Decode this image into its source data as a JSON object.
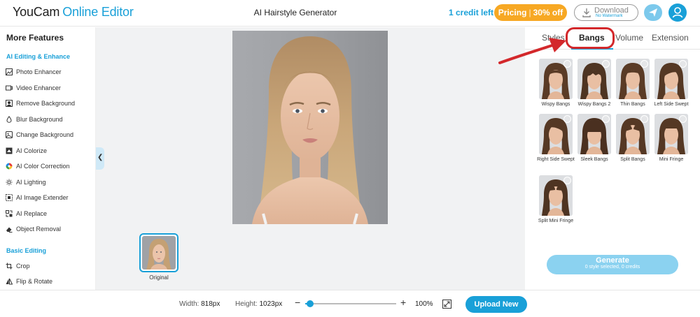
{
  "header": {
    "logo_brand": "YouCam",
    "logo_sub": "Online Editor",
    "page_title": "AI Hairstyle Generator",
    "credits": "1 credit left",
    "pricing_label": "Pricing",
    "pricing_discount": "30% off",
    "download_label": "Download",
    "download_sub": "No Watermark",
    "send_icon": "paper-plane-icon",
    "avatar_icon": "user-icon",
    "accent": "#19a0d8",
    "pricing_color": "#f7a823"
  },
  "sidebar": {
    "title": "More Features",
    "sections": [
      {
        "label": "AI Editing & Enhance",
        "items": [
          {
            "label": "Photo Enhancer",
            "icon": "image-enhance-icon"
          },
          {
            "label": "Video Enhancer",
            "icon": "video-icon"
          },
          {
            "label": "Remove Background",
            "icon": "remove-bg-icon"
          },
          {
            "label": "Blur Background",
            "icon": "droplet-icon"
          },
          {
            "label": "Change Background",
            "icon": "change-bg-icon"
          },
          {
            "label": "AI Colorize",
            "icon": "colorize-icon"
          },
          {
            "label": "AI Color Correction",
            "icon": "color-wheel-icon"
          },
          {
            "label": "AI Lighting",
            "icon": "sun-icon"
          },
          {
            "label": "AI Image Extender",
            "icon": "expand-icon"
          },
          {
            "label": "AI Replace",
            "icon": "replace-icon"
          },
          {
            "label": "Object Removal",
            "icon": "eraser-icon"
          }
        ]
      },
      {
        "label": "Basic Editing",
        "items": [
          {
            "label": "Crop",
            "icon": "crop-icon"
          },
          {
            "label": "Flip & Rotate",
            "icon": "flip-icon"
          }
        ]
      }
    ],
    "collapse_icon": "chevron-left-icon"
  },
  "canvas": {
    "thumb_label": "Original"
  },
  "right_panel": {
    "tabs": [
      "Styles",
      "Bangs",
      "Volume",
      "Extension"
    ],
    "active_tab": "Bangs",
    "styles": [
      "Wispy Bangs",
      "Wispy Bangs 2",
      "Thin Bangs",
      "Left Side Swept",
      "Right Side Swept",
      "Sleek Bangs",
      "Split Bangs",
      "Mini Fringe",
      "Split Mini Fringe"
    ],
    "generate_label": "Generate",
    "generate_sub": "0 style selected, 0 credits"
  },
  "bottom_bar": {
    "width_label": "Width:",
    "width_value": "818px",
    "height_label": "Height:",
    "height_value": "1023px",
    "zoom_value": "100%",
    "zoom_level": 0.05,
    "upload_label": "Upload New"
  }
}
